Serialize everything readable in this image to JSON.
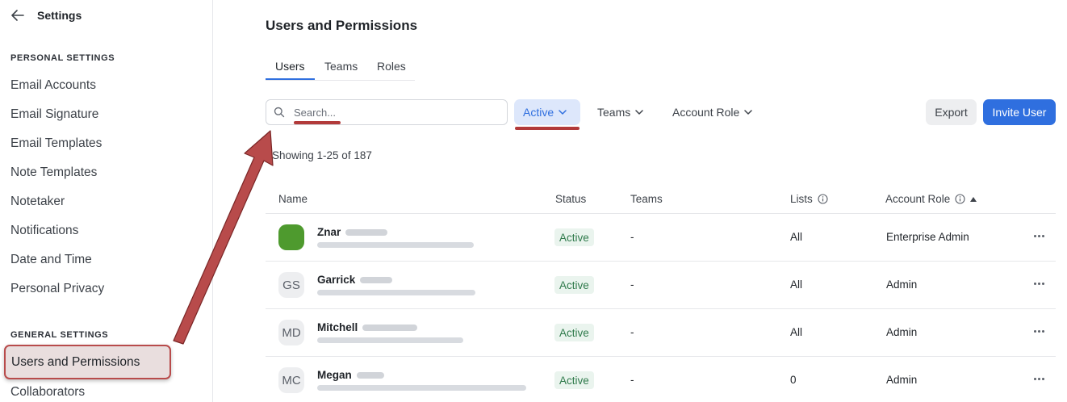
{
  "sidebar": {
    "back_icon": "arrow-left-icon",
    "title": "Settings",
    "personal_label": "PERSONAL SETTINGS",
    "personal_items": [
      "Email Accounts",
      "Email Signature",
      "Email Templates",
      "Note Templates",
      "Notetaker",
      "Notifications",
      "Date and Time",
      "Personal Privacy"
    ],
    "general_label": "GENERAL SETTINGS",
    "general_items": [
      "Users and Permissions",
      "Collaborators"
    ]
  },
  "main": {
    "title": "Users and Permissions",
    "tabs": [
      {
        "label": "Users"
      },
      {
        "label": "Teams"
      },
      {
        "label": "Roles"
      }
    ],
    "search": {
      "placeholder": "Search...",
      "icon": "search-icon"
    },
    "filters": {
      "status": "Active",
      "teams": "Teams",
      "account_role": "Account Role"
    },
    "buttons": {
      "export": "Export",
      "invite": "Invite User"
    },
    "showing": "Showing 1-25 of 187",
    "table": {
      "headers": {
        "name": "Name",
        "status": "Status",
        "teams": "Teams",
        "lists": "Lists",
        "account_role": "Account Role"
      },
      "rows": [
        {
          "initials": "",
          "first_name": "Znar",
          "status": "Active",
          "teams": "-",
          "lists": "All",
          "role": "Enterprise Admin"
        },
        {
          "initials": "GS",
          "first_name": "Garrick",
          "status": "Active",
          "teams": "-",
          "lists": "All",
          "role": "Admin"
        },
        {
          "initials": "MD",
          "first_name": "Mitchell",
          "status": "Active",
          "teams": "-",
          "lists": "All",
          "role": "Admin"
        },
        {
          "initials": "MC",
          "first_name": "Megan",
          "status": "Active",
          "teams": "-",
          "lists": "0",
          "role": "Admin"
        }
      ]
    }
  },
  "colors": {
    "accent": "#2f6fdf",
    "annotation": "#b84b4b",
    "status_green": "#2f7a4b",
    "avatar_green": "#4e9a2e"
  }
}
